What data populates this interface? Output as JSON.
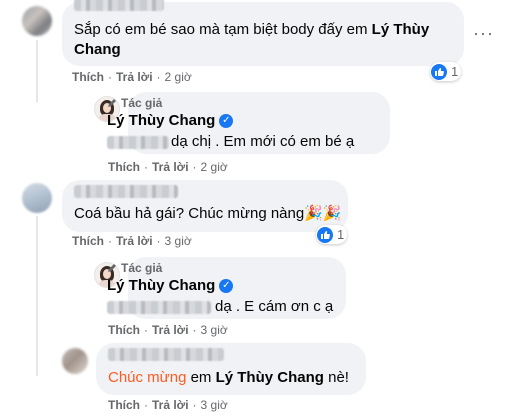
{
  "comments": [
    {
      "text_before": "Sắp có em bé sao mà tạm biệt body đấy em ",
      "mention": "Lý Thùy Chang",
      "like_label": "Thích",
      "reply_label": "Trả lời",
      "time": "2 giờ",
      "reaction_count": "1"
    },
    {
      "author_badge": "Tác giả",
      "author_name": "Lý Thùy Chang",
      "text": "dạ chị . Em mới có em bé ạ",
      "like_label": "Thích",
      "reply_label": "Trả lời",
      "time": "2 giờ"
    },
    {
      "text": "Coá bầu hả gái? Chúc mừng nàng",
      "emoji": "🎉🎉",
      "like_label": "Thích",
      "reply_label": "Trả lời",
      "time": "3 giờ",
      "reaction_count": "1"
    },
    {
      "author_badge": "Tác giả",
      "author_name": "Lý Thùy Chang",
      "text": "dạ . E cám ơn c ạ",
      "like_label": "Thích",
      "reply_label": "Trả lời",
      "time": "3 giờ"
    },
    {
      "highlight": "Chúc mừng",
      "text_mid": " em ",
      "mention": "Lý Thùy Chang",
      "text_after": " nè!",
      "like_label": "Thích",
      "reply_label": "Trả lời",
      "time": "3 giờ"
    }
  ],
  "colors": {
    "bubble": "#f0f2f5",
    "like_blue": "#1877f2",
    "highlight_orange": "#ff5a1f",
    "meta_gray": "#65676b"
  },
  "icons": {
    "more": "more-dots-icon",
    "pen": "pen-icon",
    "verified": "verified-badge-icon",
    "like": "like-reaction-icon"
  }
}
